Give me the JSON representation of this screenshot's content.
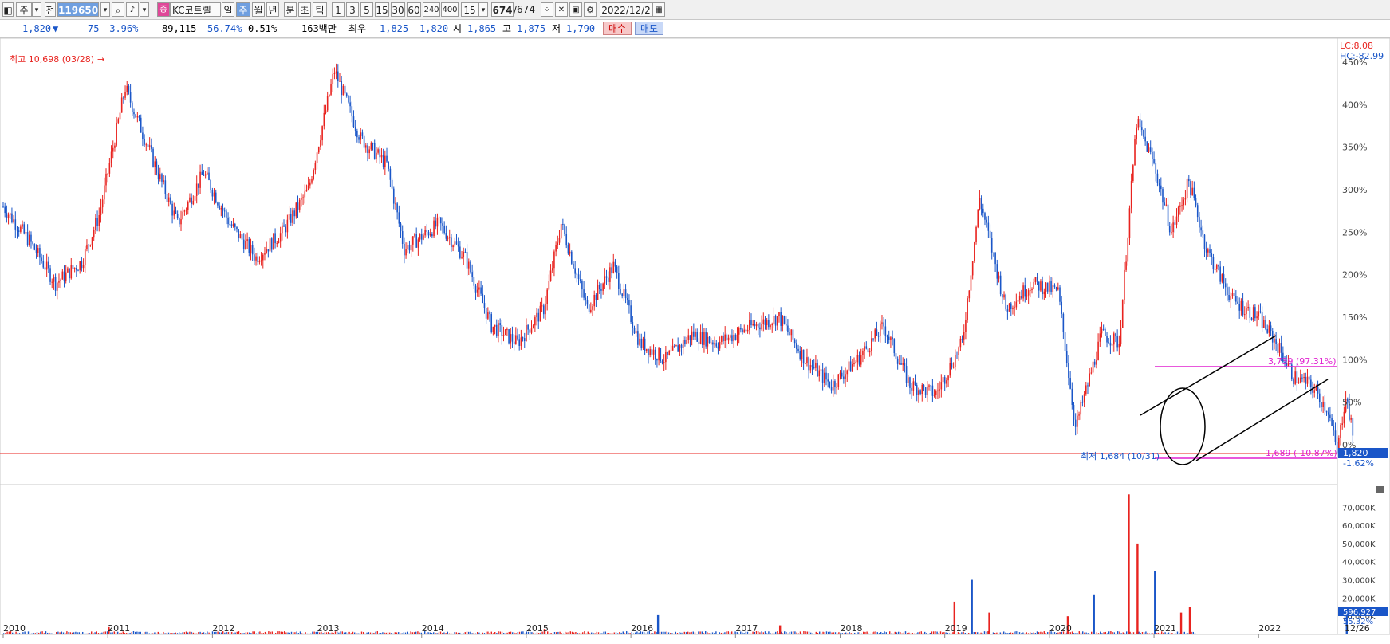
{
  "toolbar": {
    "market": "주",
    "type": "전",
    "code": "119650",
    "name": "KC코트렐",
    "periods": [
      "일",
      "주",
      "월",
      "년",
      "분",
      "초",
      "틱"
    ],
    "selected_period": "주",
    "intervals": [
      "1",
      "3",
      "5",
      "15",
      "30",
      "60",
      "240",
      "400"
    ],
    "count": "15",
    "range": "674",
    "range_total": "/674",
    "date": "2022/12/2"
  },
  "quote": {
    "price": "1,820",
    "change": "75",
    "change_pct": "-3.96%",
    "volume": "89,115",
    "vol_ratio": "56.74%",
    "turnover": "0.51%",
    "amount": "163백만",
    "bid_label": "최우",
    "bid1": "1,825",
    "bid2": "1,820",
    "open_label": "시",
    "open": "1,865",
    "high_label": "고",
    "high": "1,875",
    "low_label": "저",
    "low": "1,790",
    "buy_label": "매수",
    "sell_label": "매도"
  },
  "colors": {
    "up": "#e8231f",
    "down": "#1a56c8",
    "magenta": "#e020d0",
    "accent": "#1a56c8"
  },
  "chart_data": [
    {
      "type": "candlestick",
      "x_tick_labels": [
        "2010",
        "2011",
        "2012",
        "2013",
        "2014",
        "2015",
        "2016",
        "2017",
        "2018",
        "2019",
        "2020",
        "2021",
        "2022",
        "12/26"
      ],
      "y_tick_labels": [
        "0%",
        "50%",
        "100%",
        "150%",
        "200%",
        "250%",
        "300%",
        "350%",
        "400%",
        "450%"
      ],
      "ylim_pct": [
        -10,
        460
      ],
      "lc_label": "LC:8.08",
      "hc_label": "HC:-82.99",
      "annotations": {
        "high": "최고 10,698 (03/28)",
        "low": "최저 1,684 (10/31)",
        "upper_line": "3,739 (97.31%)",
        "lower_line": "1,689 (-10.87%)",
        "current_price": "1,820",
        "current_pct": "-1.62%"
      },
      "series_pct": [
        {
          "x": "2010-01",
          "y": 280
        },
        {
          "x": "2010-04",
          "y": 240
        },
        {
          "x": "2010-07",
          "y": 190
        },
        {
          "x": "2010-10",
          "y": 215
        },
        {
          "x": "2010-12",
          "y": 270
        },
        {
          "x": "2011-03",
          "y": 420
        },
        {
          "x": "2011-06",
          "y": 340
        },
        {
          "x": "2011-09",
          "y": 260
        },
        {
          "x": "2011-12",
          "y": 320
        },
        {
          "x": "2012-03",
          "y": 260
        },
        {
          "x": "2012-06",
          "y": 220
        },
        {
          "x": "2012-09",
          "y": 250
        },
        {
          "x": "2012-12",
          "y": 300
        },
        {
          "x": "2013-03",
          "y": 440
        },
        {
          "x": "2013-06",
          "y": 360
        },
        {
          "x": "2013-09",
          "y": 330
        },
        {
          "x": "2013-11",
          "y": 230
        },
        {
          "x": "2014-03",
          "y": 260
        },
        {
          "x": "2014-06",
          "y": 220
        },
        {
          "x": "2014-09",
          "y": 140
        },
        {
          "x": "2014-12",
          "y": 120
        },
        {
          "x": "2015-03",
          "y": 160
        },
        {
          "x": "2015-05",
          "y": 260
        },
        {
          "x": "2015-08",
          "y": 160
        },
        {
          "x": "2015-11",
          "y": 210
        },
        {
          "x": "2016-02",
          "y": 120
        },
        {
          "x": "2016-05",
          "y": 100
        },
        {
          "x": "2016-08",
          "y": 130
        },
        {
          "x": "2016-11",
          "y": 120
        },
        {
          "x": "2017-03",
          "y": 140
        },
        {
          "x": "2017-06",
          "y": 150
        },
        {
          "x": "2017-09",
          "y": 100
        },
        {
          "x": "2017-12",
          "y": 70
        },
        {
          "x": "2018-03",
          "y": 100
        },
        {
          "x": "2018-06",
          "y": 140
        },
        {
          "x": "2018-09",
          "y": 70
        },
        {
          "x": "2018-12",
          "y": 60
        },
        {
          "x": "2019-03",
          "y": 120
        },
        {
          "x": "2019-05",
          "y": 290
        },
        {
          "x": "2019-08",
          "y": 160
        },
        {
          "x": "2019-11",
          "y": 190
        },
        {
          "x": "2020-02",
          "y": 180
        },
        {
          "x": "2020-04",
          "y": 20
        },
        {
          "x": "2020-07",
          "y": 130
        },
        {
          "x": "2020-09",
          "y": 120
        },
        {
          "x": "2020-11",
          "y": 380
        },
        {
          "x": "2021-01",
          "y": 330
        },
        {
          "x": "2021-03",
          "y": 250
        },
        {
          "x": "2021-05",
          "y": 310
        },
        {
          "x": "2021-07",
          "y": 230
        },
        {
          "x": "2021-10",
          "y": 170
        },
        {
          "x": "2022-01",
          "y": 150
        },
        {
          "x": "2022-03",
          "y": 120
        },
        {
          "x": "2022-05",
          "y": 80
        },
        {
          "x": "2022-07",
          "y": 70
        },
        {
          "x": "2022-09",
          "y": 40
        },
        {
          "x": "2022-10",
          "y": -10
        },
        {
          "x": "2022-11",
          "y": 60
        },
        {
          "x": "2022-12",
          "y": -2
        }
      ]
    },
    {
      "type": "bar",
      "y_tick_labels": [
        "10,000K",
        "20,000K",
        "30,000K",
        "40,000K",
        "50,000K",
        "60,000K",
        "70,000K"
      ],
      "ylim": [
        0,
        78000000
      ],
      "current_volume": "596,927",
      "current_volume_pct": "55.32%",
      "series": [
        {
          "x": "2011-01",
          "value": 4000000
        },
        {
          "x": "2015-03",
          "value": 3000000
        },
        {
          "x": "2016-04",
          "value": 11000000
        },
        {
          "x": "2017-06",
          "value": 5000000
        },
        {
          "x": "2019-02",
          "value": 18000000
        },
        {
          "x": "2019-04",
          "value": 30000000
        },
        {
          "x": "2019-06",
          "value": 12000000
        },
        {
          "x": "2020-03",
          "value": 10000000
        },
        {
          "x": "2020-06",
          "value": 22000000
        },
        {
          "x": "2020-10",
          "value": 77000000
        },
        {
          "x": "2020-11",
          "value": 50000000
        },
        {
          "x": "2021-01",
          "value": 35000000
        },
        {
          "x": "2021-04",
          "value": 12000000
        },
        {
          "x": "2021-05",
          "value": 15000000
        },
        {
          "x": "2022-11",
          "value": 12000000
        }
      ]
    }
  ]
}
